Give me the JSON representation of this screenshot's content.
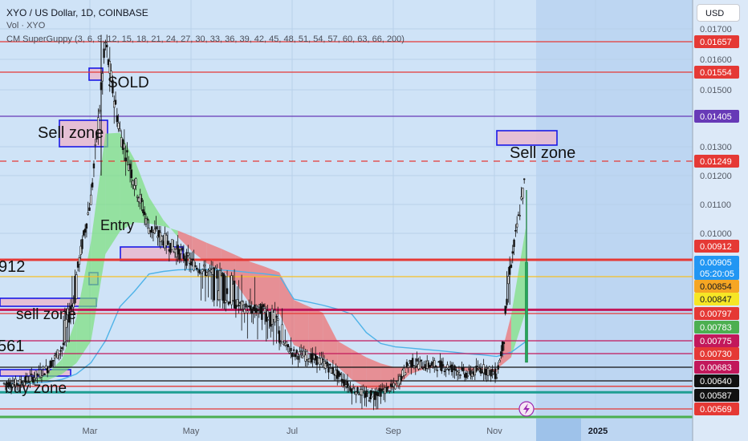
{
  "header": {
    "symbol_line": "XYO / US Dollar, 1D, COINBASE",
    "volume_line": "Vol · XYO",
    "indicator_line": "CM SuperGuppy (3, 6, 9, 12, 15, 18, 21, 24, 27, 30, 33, 36, 39, 42, 45, 48, 51, 54, 57, 60, 63, 66, 200)"
  },
  "currency_button": "USD",
  "colors": {
    "background": "#cfe3f7",
    "grid": "#b8d0ea",
    "candle_up": "#111111",
    "candle_down": "#111111",
    "red_line": "#e53935",
    "purple_line": "#673ab7",
    "yellow_line": "#f6c026",
    "teal_line": "#1e9e92",
    "green_line": "#4caf50",
    "black_line": "#111111",
    "pink_line": "#c2185b",
    "zone_fill": "#e9b9cf",
    "zone_border": "#1a1ae6",
    "current_price": "#2196f3"
  },
  "chart_data": {
    "type": "candlestick",
    "title": "XYO / US Dollar, 1D, COINBASE",
    "x_ticks": [
      "Mar",
      "May",
      "Jul",
      "Sep",
      "Nov",
      "2025"
    ],
    "y_ticks": [
      "0.01700",
      "0.01600",
      "0.01500",
      "0.01300",
      "0.01200",
      "0.01100",
      "0.01000"
    ],
    "price_tags": [
      {
        "label": "0.01657",
        "value": 0.01657,
        "color": "#e53935"
      },
      {
        "label": "0.01554",
        "value": 0.01554,
        "color": "#e53935"
      },
      {
        "label": "0.01405",
        "value": 0.01405,
        "color": "#673ab7"
      },
      {
        "label": "0.01249",
        "value": 0.01249,
        "color": "#e53935"
      },
      {
        "label": "0.00912",
        "value": 0.00912,
        "color": "#e53935"
      },
      {
        "label": "0.00905",
        "value": 0.00905,
        "color": "#2196f3"
      },
      {
        "label": "05:20:05",
        "value": 0.00892,
        "color": "#2196f3"
      },
      {
        "label": "0.00854",
        "value": 0.00854,
        "color": "#f6a623"
      },
      {
        "label": "0.00847",
        "value": 0.00847,
        "color": "#f6e626"
      },
      {
        "label": "0.00797",
        "value": 0.00797,
        "color": "#e53935"
      },
      {
        "label": "0.00783",
        "value": 0.00783,
        "color": "#4caf50"
      },
      {
        "label": "0.00775",
        "value": 0.00775,
        "color": "#c2185b"
      },
      {
        "label": "0.00730",
        "value": 0.0073,
        "color": "#e53935"
      },
      {
        "label": "0.00683",
        "value": 0.00683,
        "color": "#c2185b"
      },
      {
        "label": "0.00640",
        "value": 0.0064,
        "color": "#111111"
      },
      {
        "label": "0.00587",
        "value": 0.00587,
        "color": "#111111"
      },
      {
        "label": "0.00569",
        "value": 0.00569,
        "color": "#e53935"
      }
    ],
    "horizontal_lines": [
      {
        "value": 0.01657,
        "color": "#e53935",
        "style": "solid"
      },
      {
        "value": 0.01554,
        "color": "#e53935",
        "style": "solid"
      },
      {
        "value": 0.01405,
        "color": "#673ab7",
        "style": "solid"
      },
      {
        "value": 0.01249,
        "color": "#e53935",
        "style": "dashed"
      },
      {
        "value": 0.00912,
        "color": "#e53935",
        "style": "thick"
      },
      {
        "value": 0.00854,
        "color": "#f6c026",
        "style": "solid"
      },
      {
        "value": 0.0081,
        "color": "#c2185b",
        "style": "thick"
      },
      {
        "value": 0.00797,
        "color": "#e53935",
        "style": "solid"
      },
      {
        "value": 0.00775,
        "color": "#c2185b",
        "style": "solid"
      },
      {
        "value": 0.0073,
        "color": "#c2185b",
        "style": "solid"
      },
      {
        "value": 0.00683,
        "color": "#111111",
        "style": "solid"
      },
      {
        "value": 0.0064,
        "color": "#111111",
        "style": "solid"
      },
      {
        "value": 0.0062,
        "color": "#e53935",
        "style": "solid"
      },
      {
        "value": 0.00598,
        "color": "#1e9e92",
        "style": "thick"
      },
      {
        "value": 0.00569,
        "color": "#e53935",
        "style": "solid"
      },
      {
        "value": 0.00515,
        "color": "#4caf50",
        "style": "thick"
      }
    ],
    "annotations": [
      {
        "text": "SOLD"
      },
      {
        "text": "Sell zone"
      },
      {
        "text": "Sell zone"
      },
      {
        "text": "Entry"
      },
      {
        "text": "912"
      },
      {
        "text": "sell zone"
      },
      {
        "text": "561"
      },
      {
        "text": "buy zone"
      }
    ],
    "close_path": [
      0.0063,
      0.0063,
      0.0065,
      0.0068,
      0.0075,
      0.0086,
      0.0112,
      0.0165,
      0.0135,
      0.0118,
      0.0102,
      0.0098,
      0.0094,
      0.009,
      0.0087,
      0.0086,
      0.0083,
      0.0081,
      0.0081,
      0.0078,
      0.0073,
      0.0072,
      0.007,
      0.0066,
      0.0061,
      0.0059,
      0.006,
      0.0062,
      0.007,
      0.0069,
      0.0069,
      0.0068,
      0.0066,
      0.0068,
      0.0066,
      0.009,
      0.012
    ]
  }
}
